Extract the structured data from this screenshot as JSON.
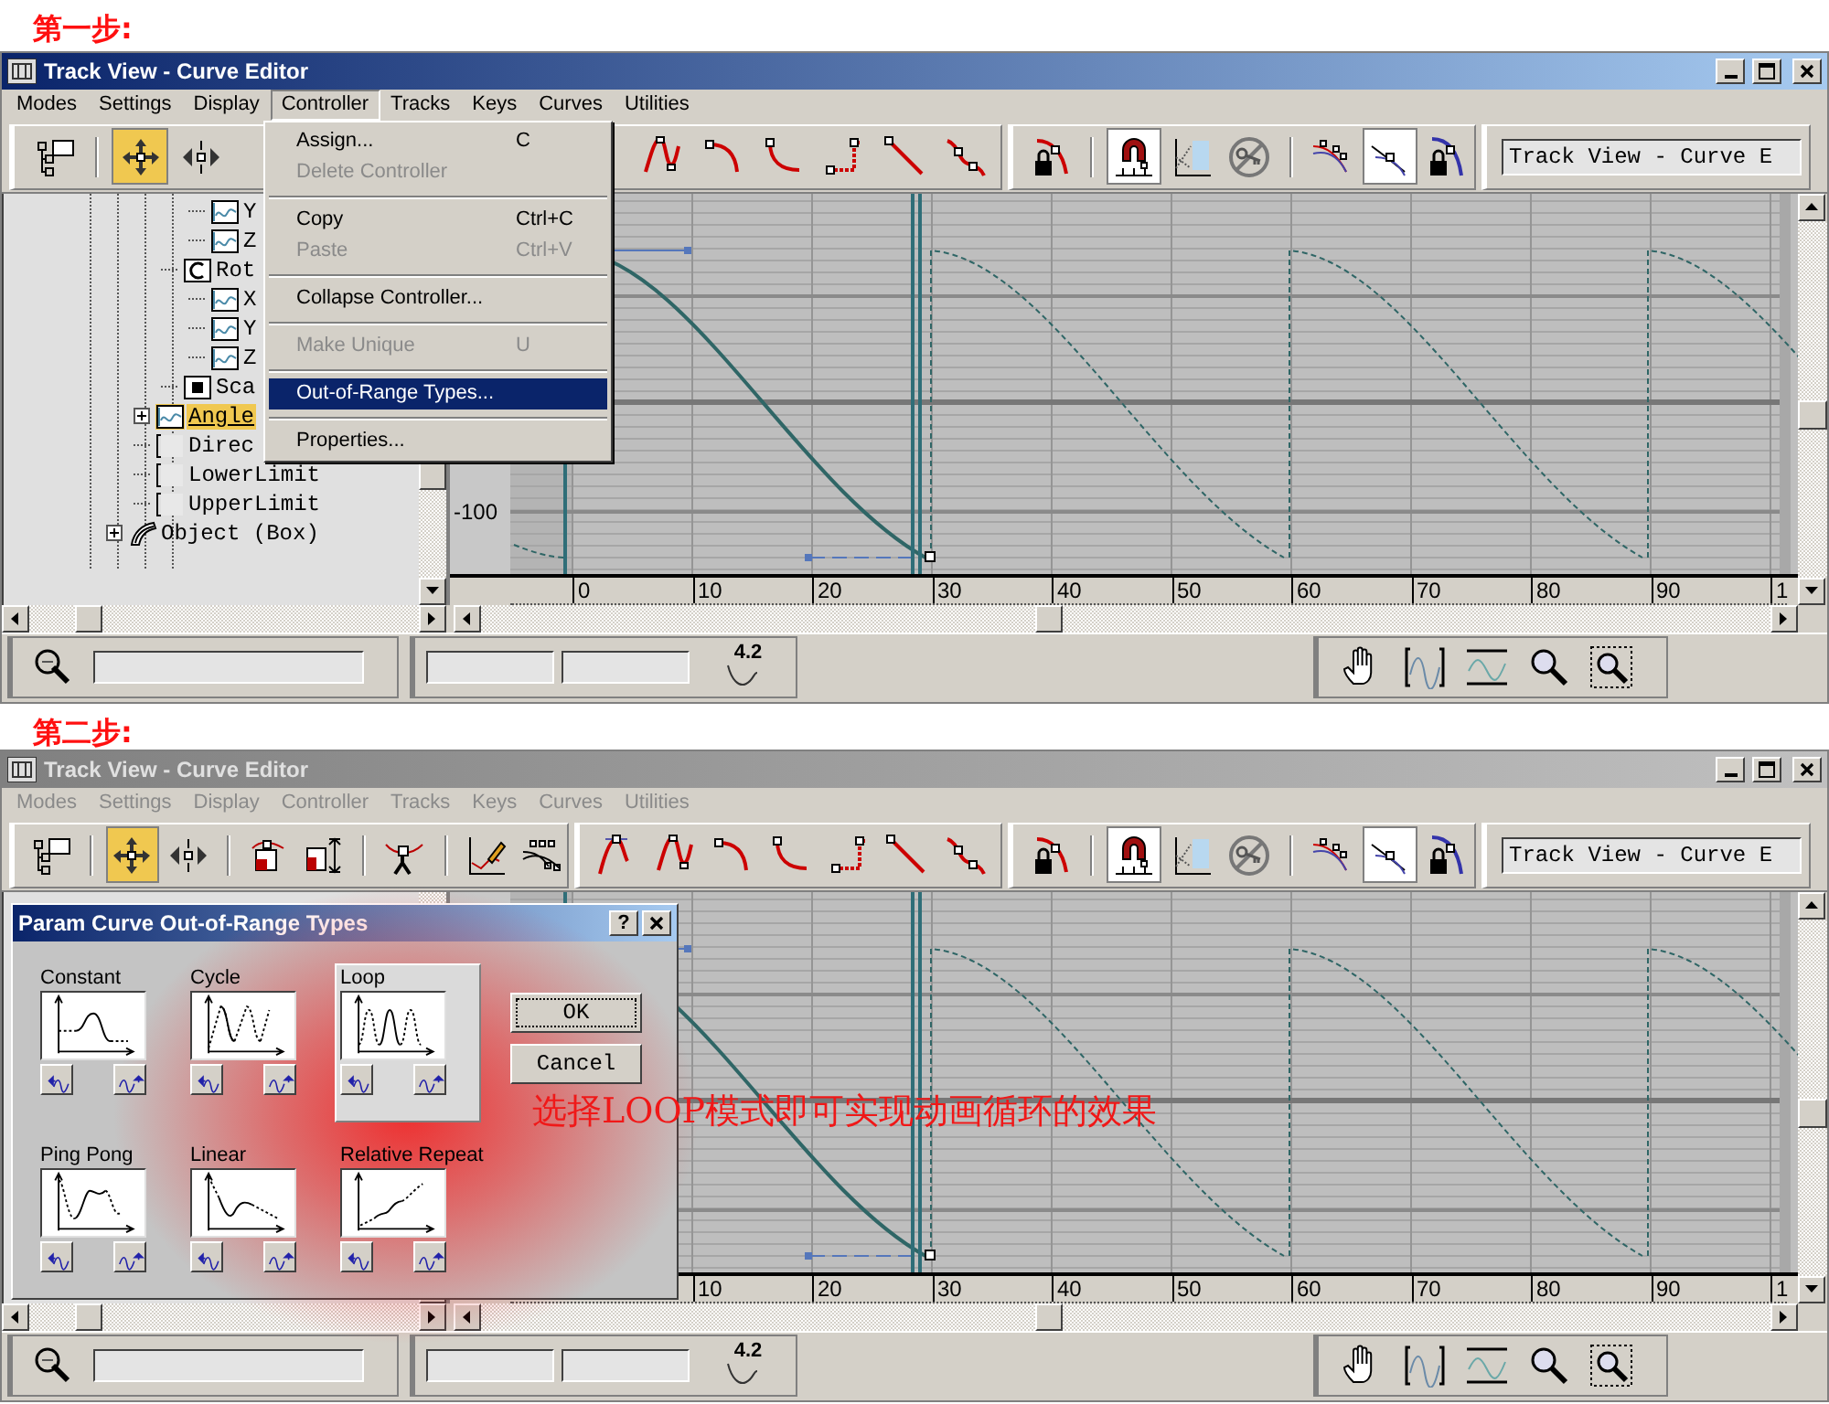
{
  "steps": [
    {
      "heading": "第一步:",
      "window": {
        "title": "Track View - Curve Editor",
        "active": true
      },
      "menu_bar": [
        {
          "label": "Modes",
          "selected": false,
          "disabled": false
        },
        {
          "label": "Settings",
          "selected": false,
          "disabled": false
        },
        {
          "label": "Display",
          "selected": false,
          "disabled": false
        },
        {
          "label": "Controller",
          "selected": true,
          "disabled": false
        },
        {
          "label": "Tracks",
          "selected": false,
          "disabled": false
        },
        {
          "label": "Keys",
          "selected": false,
          "disabled": false
        },
        {
          "label": "Curves",
          "selected": false,
          "disabled": false
        },
        {
          "label": "Utilities",
          "selected": false,
          "disabled": false
        }
      ],
      "dropdown": [
        {
          "kind": "item",
          "label": "Assign...",
          "shortcut": "C",
          "disabled": false,
          "selected": false
        },
        {
          "kind": "item",
          "label": "Delete Controller",
          "disabled": true,
          "selected": false
        },
        {
          "kind": "separator"
        },
        {
          "kind": "item",
          "label": "Copy",
          "shortcut": "Ctrl+C",
          "disabled": false,
          "selected": false
        },
        {
          "kind": "item",
          "label": "Paste",
          "shortcut": "Ctrl+V",
          "disabled": true,
          "selected": false
        },
        {
          "kind": "separator"
        },
        {
          "kind": "item",
          "label": "Collapse Controller...",
          "disabled": false,
          "selected": false
        },
        {
          "kind": "separator"
        },
        {
          "kind": "item",
          "label": "Make Unique",
          "shortcut": "U",
          "disabled": true,
          "selected": false
        },
        {
          "kind": "separator"
        },
        {
          "kind": "item",
          "label": "Out-of-Range Types...",
          "disabled": false,
          "selected": true
        },
        {
          "kind": "separator"
        },
        {
          "kind": "item",
          "label": "Properties...",
          "disabled": false,
          "selected": false
        }
      ],
      "toolbar": [
        [
          {
            "kind": "hierarchy",
            "selected": false
          },
          {
            "kind": "separator"
          },
          {
            "kind": "move",
            "selected": true
          },
          {
            "kind": "slide",
            "selected": false
          }
        ],
        [
          {
            "kind": "t_custom",
            "selected": false
          },
          {
            "kind": "t_fast",
            "selected": false
          },
          {
            "kind": "t_slow",
            "selected": false
          },
          {
            "kind": "t_step",
            "selected": false
          },
          {
            "kind": "t_linear",
            "selected": false
          },
          {
            "kind": "t_smooth",
            "selected": false
          }
        ],
        [
          {
            "kind": "lock_keys",
            "selected": false
          },
          {
            "kind": "separator"
          },
          {
            "kind": "snap",
            "selected": true
          },
          {
            "kind": "show_keyable",
            "selected": false
          },
          {
            "kind": "no_key",
            "selected": false
          },
          {
            "kind": "separator"
          },
          {
            "kind": "show_tangents",
            "selected": false
          },
          {
            "kind": "show_handles",
            "selected": true
          },
          {
            "kind": "lock_tangents",
            "selected": false
          }
        ]
      ],
      "toolbar_field": "Track View - Curve E",
      "tree": [
        {
          "children": [
            {
              "children": [
                {
                  "children": [
                    {
                      "label": "Y",
                      "kind": "curve",
                      "selected": false
                    },
                    {
                      "label": "Z",
                      "kind": "curve",
                      "selected": false
                    }
                  ]
                },
                {
                  "label": "Rot",
                  "kind": "rotation",
                  "selected": false,
                  "children": [
                    {
                      "label": "X",
                      "kind": "curve",
                      "selected": false
                    },
                    {
                      "label": "Y",
                      "kind": "curve",
                      "selected": false
                    },
                    {
                      "label": "Z",
                      "kind": "curve",
                      "selected": false
                    }
                  ]
                },
                {
                  "label": "Sca",
                  "kind": "scale",
                  "selected": false
                }
              ]
            },
            {
              "label": "Angle",
              "kind": "curve",
              "selected": true,
              "collapsed": true
            },
            {
              "label": "Direc",
              "kind": "blank",
              "selected": false
            },
            {
              "label": "LowerLimit",
              "kind": "blank",
              "selected": false
            },
            {
              "label": "UpperLimit",
              "kind": "blank",
              "selected": false
            }
          ]
        },
        {
          "label": "Object (Box)",
          "kind": "object",
          "selected": false,
          "collapsed": true
        }
      ],
      "graph": {
        "value_labels": [
          "-100"
        ],
        "ruler_labels": [
          "0",
          "10",
          "20",
          "30",
          "40",
          "50",
          "60",
          "70",
          "80",
          "90",
          "1"
        ]
      },
      "status_bar": {
        "value_display": "4.2"
      }
    },
    {
      "heading": "第二步:",
      "window": {
        "title": "Track View - Curve Editor",
        "active": false
      },
      "menu_bar": [
        {
          "label": "Modes",
          "selected": false,
          "disabled": true
        },
        {
          "label": "Settings",
          "selected": false,
          "disabled": true
        },
        {
          "label": "Display",
          "selected": false,
          "disabled": true
        },
        {
          "label": "Controller",
          "selected": false,
          "disabled": true
        },
        {
          "label": "Tracks",
          "selected": false,
          "disabled": true
        },
        {
          "label": "Keys",
          "selected": false,
          "disabled": true
        },
        {
          "label": "Curves",
          "selected": false,
          "disabled": true
        },
        {
          "label": "Utilities",
          "selected": false,
          "disabled": true
        }
      ],
      "toolbar": [
        [
          {
            "kind": "hierarchy",
            "selected": false
          },
          {
            "kind": "separator"
          },
          {
            "kind": "move",
            "selected": true
          },
          {
            "kind": "slide",
            "selected": false
          },
          {
            "kind": "separator"
          },
          {
            "kind": "scale_keys",
            "selected": false
          },
          {
            "kind": "scale_values",
            "selected": false
          },
          {
            "kind": "separator"
          },
          {
            "kind": "add_keys",
            "selected": false
          },
          {
            "kind": "separator"
          },
          {
            "kind": "draw_curves",
            "selected": false
          },
          {
            "kind": "reduce_keys",
            "selected": false
          }
        ],
        [
          {
            "kind": "t_auto",
            "selected": false
          },
          {
            "kind": "t_custom",
            "selected": false
          },
          {
            "kind": "t_fast",
            "selected": false
          },
          {
            "kind": "t_slow",
            "selected": false
          },
          {
            "kind": "t_step",
            "selected": false
          },
          {
            "kind": "t_linear",
            "selected": false
          },
          {
            "kind": "t_smooth",
            "selected": false
          }
        ],
        [
          {
            "kind": "lock_keys",
            "selected": false
          },
          {
            "kind": "separator"
          },
          {
            "kind": "snap",
            "selected": true
          },
          {
            "kind": "show_keyable",
            "selected": false
          },
          {
            "kind": "no_key",
            "selected": false
          },
          {
            "kind": "separator"
          },
          {
            "kind": "show_tangents",
            "selected": false
          },
          {
            "kind": "show_handles",
            "selected": true
          },
          {
            "kind": "lock_tangents",
            "selected": false
          }
        ]
      ],
      "toolbar_field": "Track View - Curve E",
      "graph": {
        "ruler_labels": [
          "10",
          "20",
          "30",
          "40",
          "50",
          "60",
          "70",
          "80",
          "90",
          "1"
        ]
      },
      "dialog": {
        "title": "Param Curve Out-of-Range Types",
        "help": "?",
        "options": [
          {
            "kind": "constant",
            "label": "Constant",
            "selected": false
          },
          {
            "kind": "cycle",
            "label": "Cycle",
            "selected": false
          },
          {
            "kind": "loop",
            "label": "Loop",
            "selected": true
          },
          {
            "kind": "pingpong",
            "label": "Ping Pong",
            "selected": false
          },
          {
            "kind": "linear",
            "label": "Linear",
            "selected": false
          },
          {
            "kind": "relative",
            "label": "Relative Repeat",
            "selected": false
          }
        ],
        "buttons": [
          {
            "label": "OK",
            "focused": true
          },
          {
            "label": "Cancel",
            "focused": false
          }
        ]
      },
      "annotation": "选择LOOP模式即可实现动画循环的效果",
      "status_bar": {
        "value_display": "4.2"
      }
    }
  ]
}
